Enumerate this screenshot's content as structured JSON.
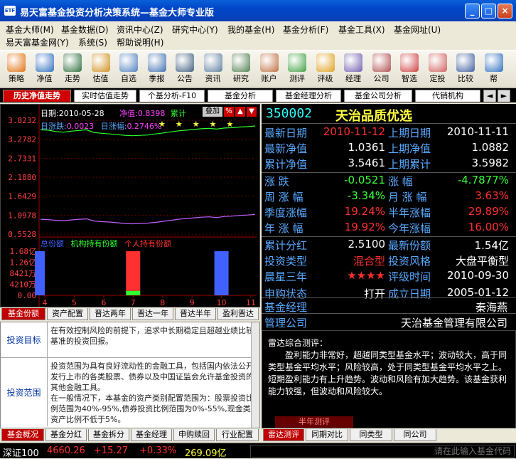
{
  "window": {
    "title": "易天富基金投资分析决策系统—基金大师专业版",
    "app_icon": "app-logo-icon",
    "buttons": [
      "_",
      "□",
      "×"
    ]
  },
  "menu": {
    "row1": [
      "基金大师(M)",
      "基金数据(D)",
      "资讯中心(Z)",
      "研究中心(Y)",
      "我的基金(H)",
      "基金分析(F)",
      "基金工具(X)",
      "基金网址(U)"
    ],
    "row2": [
      "易天富基金网(Y)",
      "系统(S)",
      "帮助说明(H)"
    ]
  },
  "toolbar": [
    {
      "label": "策略",
      "icon": "strategy-icon",
      "color": "#e07010"
    },
    {
      "label": "净值",
      "icon": "nav-icon",
      "color": "#3070c0"
    },
    {
      "label": "走势",
      "icon": "trend-icon",
      "color": "#307040"
    },
    {
      "label": "估值",
      "icon": "valuation-icon",
      "color": "#d09020"
    },
    {
      "label": "自选",
      "icon": "watchlist-icon",
      "color": "#5080c0"
    },
    {
      "label": "季报",
      "icon": "quarterly-report-icon",
      "color": "#4070b0"
    },
    {
      "label": "公告",
      "icon": "announcement-icon",
      "color": "#406080"
    },
    {
      "label": "资讯",
      "icon": "news-icon",
      "color": "#6080a0"
    },
    {
      "label": "研究",
      "icon": "research-icon",
      "color": "#508050"
    },
    {
      "label": "账户",
      "icon": "account-icon",
      "color": "#c07040"
    },
    {
      "label": "测评",
      "icon": "evaluation-icon",
      "color": "#40a040"
    },
    {
      "label": "评级",
      "icon": "rating-icon",
      "color": "#e0a020"
    },
    {
      "label": "经理",
      "icon": "manager-icon",
      "color": "#7060b0"
    },
    {
      "label": "公司",
      "icon": "company-icon",
      "color": "#b05050"
    },
    {
      "label": "智选",
      "icon": "smart-select-icon",
      "color": "#d04040"
    },
    {
      "label": "定投",
      "icon": "fixed-invest-icon",
      "color": "#d06060"
    },
    {
      "label": "比较",
      "icon": "compare-icon",
      "color": "#4060a0"
    },
    {
      "label": "帮",
      "icon": "help-icon",
      "color": "#3070c0"
    }
  ],
  "top_tabs": [
    "历史净值走势",
    "实时估值走势",
    "个基分析-F10",
    "基金分析",
    "基金经理分析",
    "基金公司分析",
    "代销机构"
  ],
  "chart": {
    "date_label": "日期:",
    "date": "2010-05-28",
    "nav_label": "净值:",
    "nav": "0.8398",
    "cum_label": "累计",
    "stack_btn": "叠加",
    "pct_btn": "%",
    "daily_change_label": "日涨跌:",
    "daily_change": "0.0023",
    "daily_pct_label": "日涨幅:",
    "daily_pct": "0.2746%"
  },
  "chart_data": [
    {
      "type": "line",
      "ylim": [
        0.5528,
        3.8232
      ],
      "yticks": [
        "3.8232",
        "3.2782",
        "2.7331",
        "2.1880",
        "1.6429",
        "1.0978",
        "0.5528"
      ],
      "series": [
        {
          "name": "净值",
          "color": "#c060ff",
          "values": [
            0.98,
            0.97,
            0.95,
            0.94,
            0.96,
            0.98,
            0.99,
            0.93,
            0.91,
            0.9,
            0.88,
            0.86,
            0.85,
            0.86,
            0.87,
            0.89,
            0.92,
            0.95,
            0.98,
            1.0,
            1.02,
            1.04,
            1.05,
            1.03,
            1.06,
            1.07,
            1.09,
            1.1,
            1.12
          ]
        },
        {
          "name": "累计",
          "color": "#30ff30",
          "values": [
            3.55,
            3.54,
            3.5,
            3.48,
            3.51,
            3.53,
            3.55,
            3.47,
            3.45,
            3.43,
            3.41,
            3.39,
            3.38,
            3.39,
            3.4,
            3.43,
            3.46,
            3.49,
            3.52,
            3.54,
            3.56,
            3.58,
            3.59,
            3.57,
            3.6,
            3.61,
            3.63,
            3.64,
            3.66
          ]
        }
      ]
    },
    {
      "type": "bar",
      "legend": [
        "总份额",
        "机构持有份额",
        "个人持有份额"
      ],
      "legend_colors": [
        "#4060ff",
        "#30ff30",
        "#ff3030"
      ],
      "yticks": [
        "1.68亿",
        "1.26亿",
        "8421万",
        "4210万",
        "0.00"
      ],
      "ylim": [
        0,
        1.68
      ],
      "x_ticks": [
        "4",
        "5",
        "6",
        "7",
        "8",
        "9",
        "10",
        "11"
      ],
      "bars": [
        {
          "x": "4",
          "total": 1.68,
          "institution": 0,
          "personal": 0
        },
        {
          "x": "7",
          "total": 1.68,
          "institution": 0.17,
          "personal": 1.51
        },
        {
          "x": "10",
          "total": 1.68,
          "institution": 0,
          "personal": 0
        }
      ]
    }
  ],
  "fund": {
    "code": "350002",
    "name": "天治品质优选",
    "rows": [
      {
        "l1": "最新日期",
        "v1": "2010-11-12",
        "l2": "上期日期",
        "v2": "2010-11-11"
      },
      {
        "l1": "最新净值",
        "v1": "1.0361",
        "l2": "上期净值",
        "v2": "1.0882"
      },
      {
        "l1": "累计净值",
        "v1": "3.5461",
        "l2": "上期累计",
        "v2": "3.5982"
      },
      {
        "l1": "涨    跌",
        "v1": "-0.0521",
        "l2": "涨    幅",
        "v2": "-4.7877%"
      },
      {
        "l1": "周 涨 幅",
        "v1": "-3.34%",
        "l2": "月 涨 幅",
        "v2": "3.63%"
      },
      {
        "l1": "季度涨幅",
        "v1": "19.24%",
        "l2": "半年涨幅",
        "v2": "29.89%"
      },
      {
        "l1": "年 涨 幅",
        "v1": "19.92%",
        "l2": "今年涨幅",
        "v2": "16.00%"
      },
      {
        "l1": "累计分红",
        "v1": "2.5100",
        "l2": "最新份额",
        "v2": "1.54亿"
      },
      {
        "l1": "投资类型",
        "v1": "混合型",
        "l2": "投资风格",
        "v2": "大盘平衡型"
      },
      {
        "l1": "晨星三年",
        "v1": "★★★★",
        "l2": "评级时间",
        "v2": "2010-09-30"
      },
      {
        "l1": "申购状态",
        "v1": "打开",
        "l2": "成立日期",
        "v2": "2005-01-12"
      }
    ],
    "manager_label": "基金经理",
    "manager": "秦海燕",
    "company_label": "管理公司",
    "company": "天治基金管理有限公司"
  },
  "left_bottom_tabs1": [
    "基金份额",
    "资产配置",
    "晋达两年",
    "晋达一年",
    "晋达半年",
    "盈利晋达"
  ],
  "info": [
    {
      "label": "投资目标",
      "text": "在有效控制风险的前提下，追求中长期稳定且超越业绩比较基准的投资回报。"
    },
    {
      "label": "投资范围",
      "text": "投资范围为具有良好流动性的金融工具，包括国内依法公开发行上市的各类股票、债券以及中国证监会允许基金投资的其他金融工具。\n在一般情况下，本基金的资产类别配置范围为：股票投资比例范围为40%-95%,债券投资比例范围为0%-55%,现金类资产比例不低于5%。"
    }
  ],
  "left_bottom_tabs2": [
    "基金概况",
    "基金分红",
    "基金拆分",
    "基金经理",
    "申购赎回",
    "行业配置"
  ],
  "review": {
    "title": "雷达综合测评：",
    "text": "盈利能力非常好，超越同类型基金水平；波动较大，高于同类型基金平均水平；风险较高，处于同类型基金平均水平之上。短期盈利能力有上升趋势。波动和风险有加大趋势。该基金获利能力较强，但波动和风险较大。",
    "sub": "半年测评"
  },
  "right_bottom_tabs": [
    "雷达测评",
    "同期对比",
    "同类型",
    "同公司"
  ],
  "status": {
    "index_name": "深证100",
    "index_value": "4660.26",
    "change": "+15.27",
    "pct": "+0.33%",
    "volume": "269.09亿",
    "input_placeholder": "请在此输入基金代码"
  }
}
